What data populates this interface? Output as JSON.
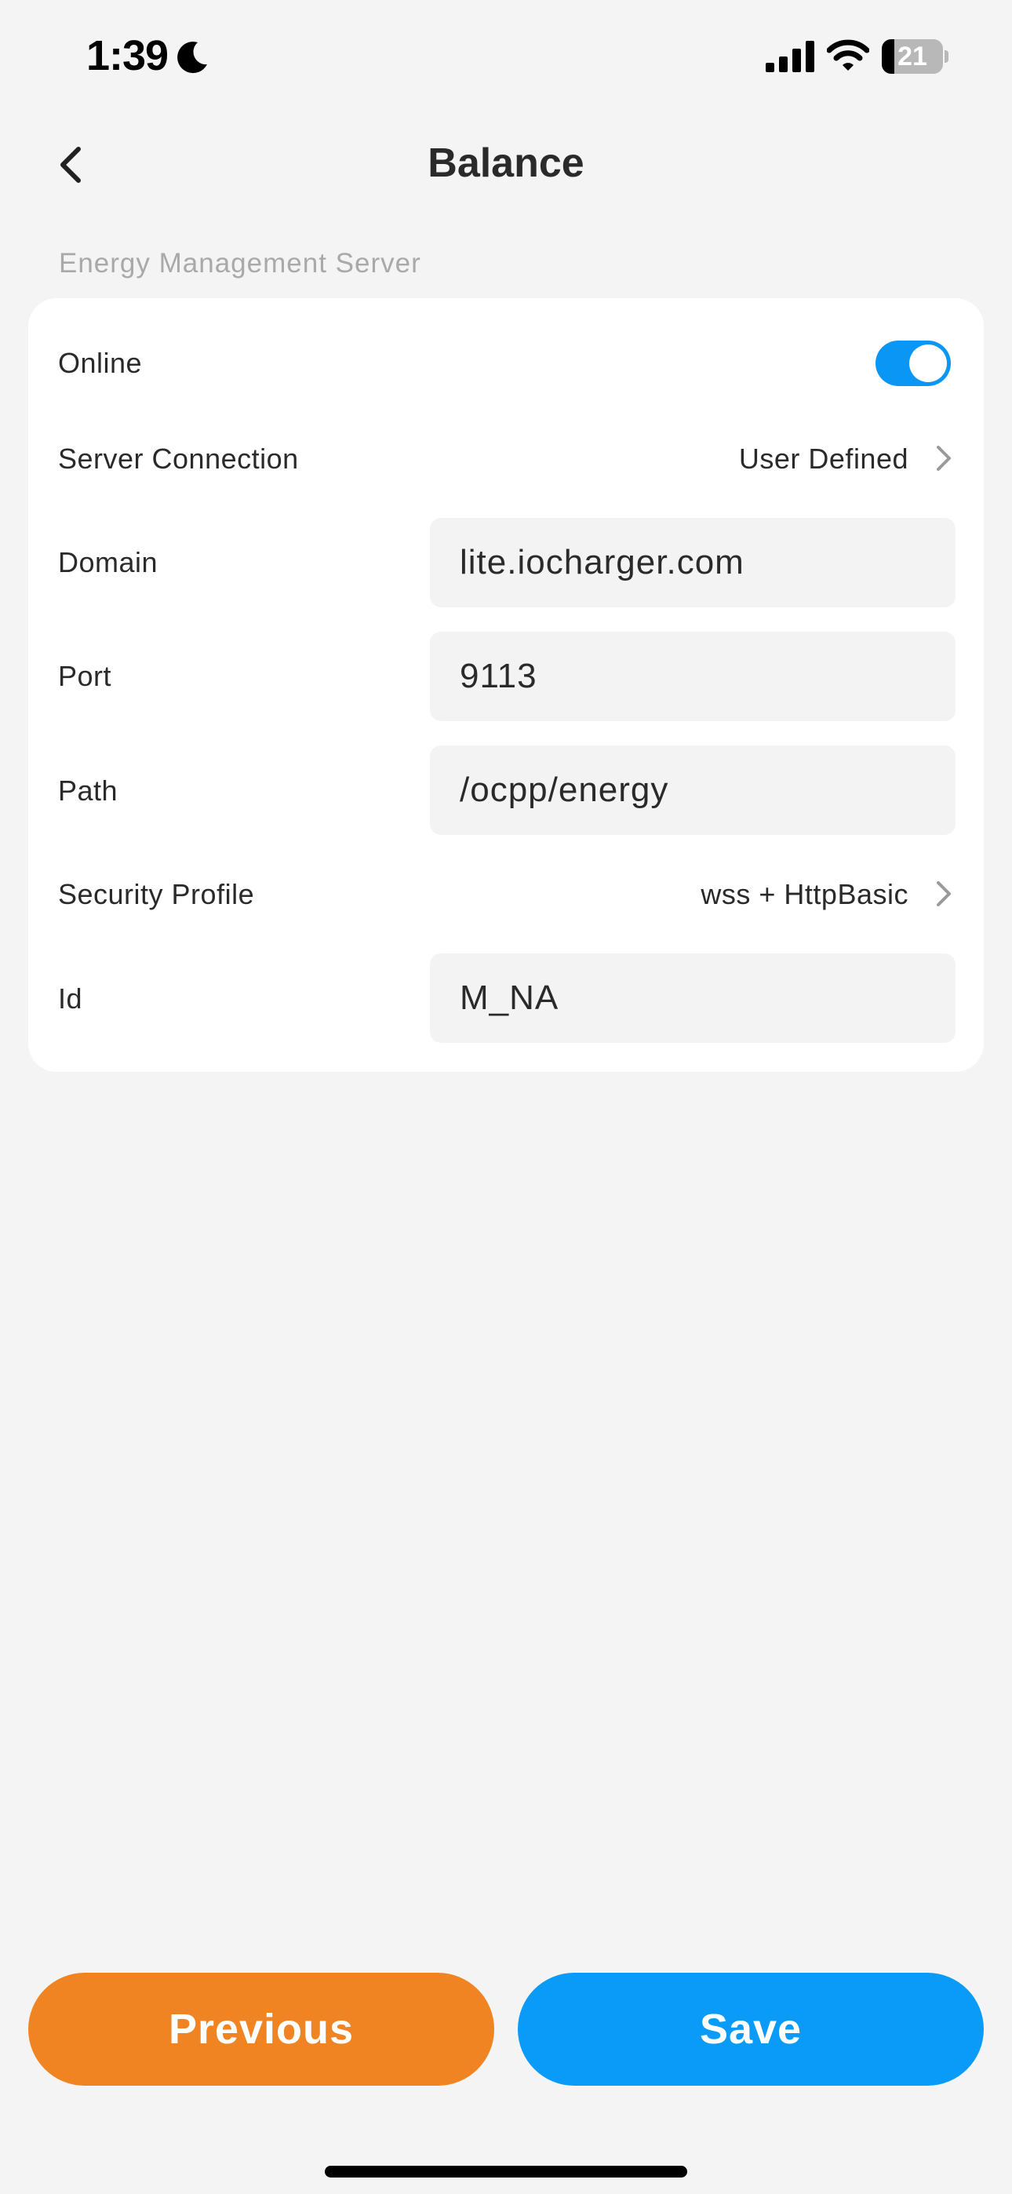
{
  "status_bar": {
    "time": "1:39",
    "battery_level": "21",
    "battery_fraction": 0.21,
    "icons": [
      "moon-icon",
      "signal-icon",
      "wifi-icon",
      "battery-icon"
    ]
  },
  "header": {
    "title": "Balance",
    "back_icon": "chevron-left-icon"
  },
  "section": {
    "label": "Energy Management Server"
  },
  "form": {
    "online": {
      "label": "Online",
      "enabled": true
    },
    "server_connection": {
      "label": "Server Connection",
      "value": "User Defined"
    },
    "domain": {
      "label": "Domain",
      "value": "lite.iocharger.com"
    },
    "port": {
      "label": "Port",
      "value": "9113"
    },
    "path": {
      "label": "Path",
      "value": "/ocpp/energy"
    },
    "security_profile": {
      "label": "Security Profile",
      "value": "wss + HttpBasic"
    },
    "id": {
      "label": "Id",
      "value": "M_NA"
    }
  },
  "buttons": {
    "previous": "Previous",
    "save": "Save"
  },
  "colors": {
    "accent_blue": "#0a9af7",
    "accent_orange": "#f08322",
    "background": "#f4f4f4",
    "card": "#ffffff",
    "input_bg": "#f3f3f3"
  }
}
